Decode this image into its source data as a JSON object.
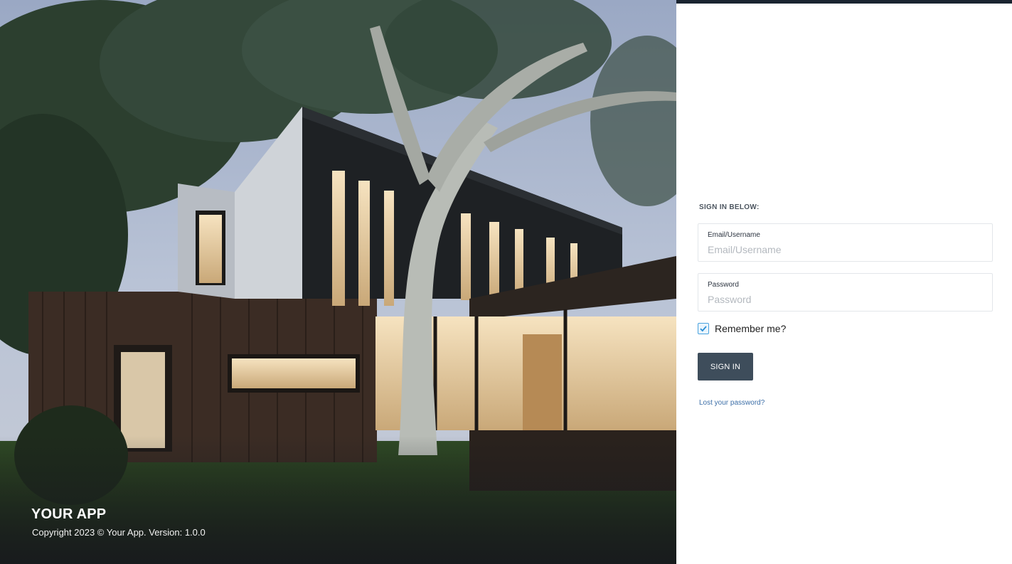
{
  "brand": {
    "title": "YOUR APP",
    "copyright": "Copyright 2023 © Your App. Version: 1.0.0"
  },
  "signin": {
    "heading": "SIGN IN BELOW:",
    "email": {
      "label": "Email/Username",
      "placeholder": "Email/Username",
      "value": ""
    },
    "password": {
      "label": "Password",
      "placeholder": "Password",
      "value": ""
    },
    "remember": {
      "label": "Remember me?",
      "checked": true
    },
    "button_label": "SIGN IN",
    "lost_password_link": "Lost your password?"
  },
  "colors": {
    "accent_dark": "#3e4d5b",
    "top_strip": "#1a2430",
    "link": "#3d6fa8",
    "checkbox": "#4aa3df"
  },
  "icons": {
    "checkbox_icon": "check-icon"
  }
}
